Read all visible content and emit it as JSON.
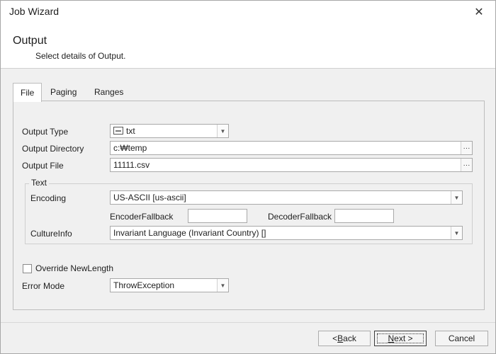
{
  "window": {
    "title": "Job Wizard",
    "close_glyph": "✕"
  },
  "header": {
    "title": "Output",
    "subtitle": "Select details of Output."
  },
  "tabs": [
    {
      "label": "File",
      "active": true
    },
    {
      "label": "Paging",
      "active": false
    },
    {
      "label": "Ranges",
      "active": false
    }
  ],
  "file_tab": {
    "output_type_label": "Output Type",
    "output_type_value": "txt",
    "output_type_icon": "txt-file-icon",
    "output_directory_label": "Output Directory",
    "output_directory_value": "c:₩temp",
    "output_file_label": "Output File",
    "output_file_value": "11111.csv",
    "browse_glyph": "···",
    "text_group": {
      "title": "Text",
      "encoding_label": "Encoding",
      "encoding_value": "US-ASCII [us-ascii]",
      "encoder_fallback_label": "EncoderFallback",
      "encoder_fallback_value": "",
      "decoder_fallback_label": "DecoderFallback",
      "decoder_fallback_value": "",
      "culture_info_label": "CultureInfo",
      "culture_info_value": "Invariant Language (Invariant Country) []"
    },
    "override_new_length_label": "Override NewLength",
    "override_new_length_checked": false,
    "error_mode_label": "Error Mode",
    "error_mode_value": "ThrowException"
  },
  "footer": {
    "back_prefix": "< ",
    "back_key": "B",
    "back_rest": "ack",
    "next_key": "N",
    "next_rest": "ext >",
    "cancel_label": "Cancel"
  }
}
